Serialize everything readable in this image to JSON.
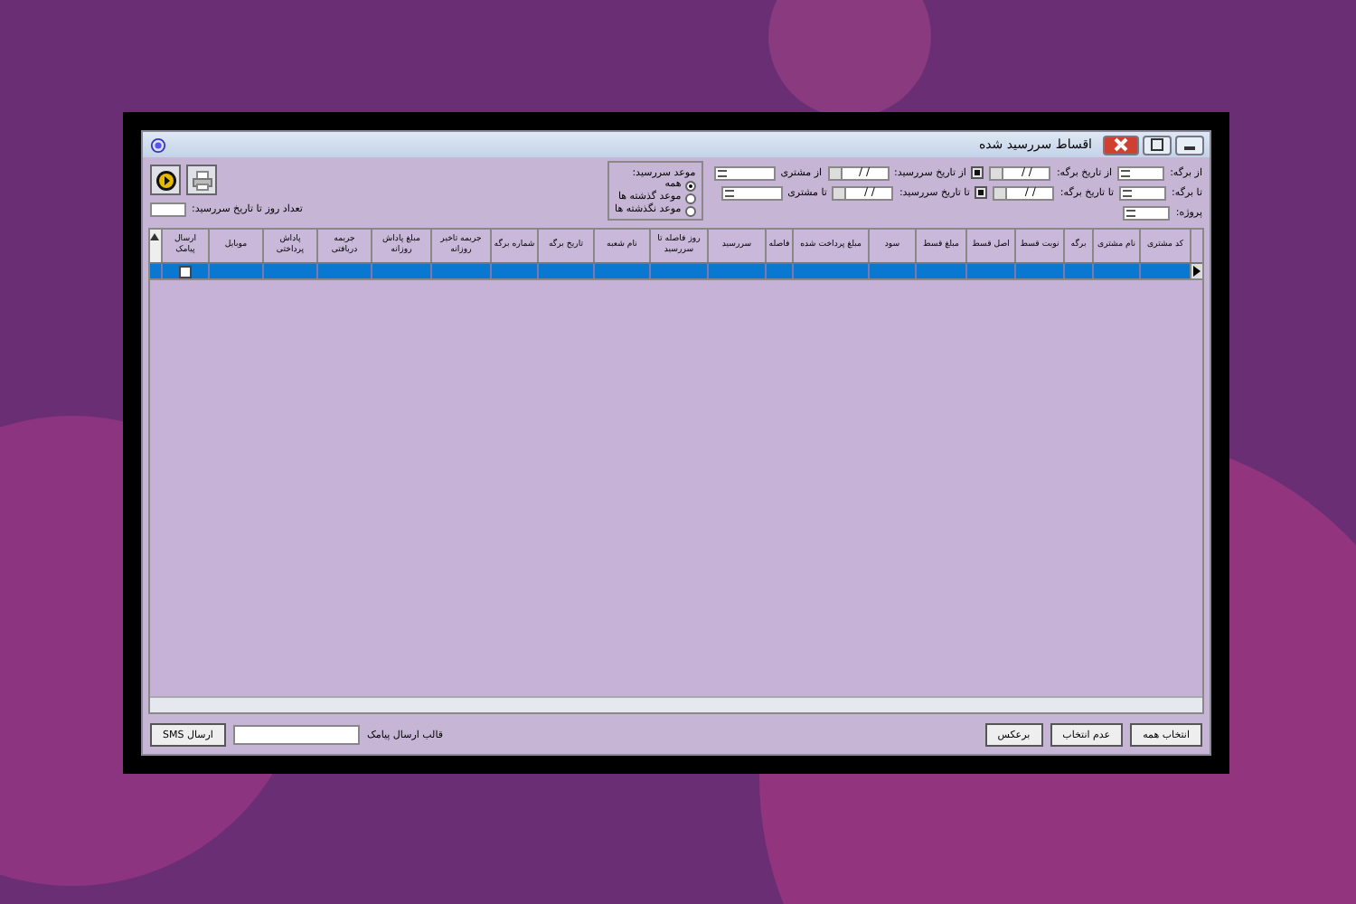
{
  "window": {
    "title": "اقساط سررسید شده"
  },
  "filters": {
    "rows": [
      {
        "sheet_label": "از برگه:",
        "sheet_date_label": "از تاریخ برگه:",
        "due_date_label": "از تاریخ سررسید:",
        "customer_label": "از مشتری",
        "date_value": "/ /"
      },
      {
        "sheet_label": "تا برگه:",
        "sheet_date_label": "تا تاریخ برگه:",
        "due_date_label": "تا تاریخ سررسید:",
        "customer_label": "تا مشتری",
        "date_value": "/ /"
      }
    ],
    "project_label": "پروژه:",
    "due_group": {
      "title": "موعد سررسید:",
      "options": [
        {
          "label": "همه",
          "selected": true
        },
        {
          "label": "موعد گذشته ها",
          "selected": false
        },
        {
          "label": "موعد نگذشته ها",
          "selected": false
        }
      ]
    },
    "days_label": "تعداد روز تا تاریخ سررسید:"
  },
  "table": {
    "columns": [
      "کد مشتری",
      "نام مشتری",
      "برگه",
      "نوبت قسط",
      "اصل قسط",
      "مبلغ قسط",
      "سود",
      "مبلغ پرداخت شده",
      "فاصله",
      "سررسید",
      "روز فاصله تا سررسید",
      "نام شعبه",
      "تاریخ برگه",
      "شماره برگه",
      "جریمه تاخیر روزانه",
      "مبلغ پاداش روزانه",
      "جریمه دریافتی",
      "پاداش پرداختی",
      "موبایل",
      "ارسال پیامک"
    ],
    "rows": [
      {
        "selected": true,
        "send_sms": false
      }
    ]
  },
  "footer": {
    "buttons": [
      "انتخاب همه",
      "عدم انتخاب",
      "برعکس"
    ],
    "template_label": "قالب ارسال پیامک",
    "send_button": "ارسال SMS"
  }
}
